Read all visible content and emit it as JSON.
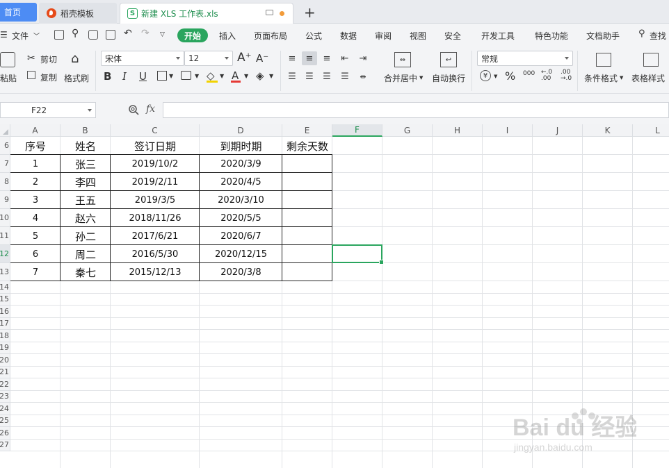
{
  "tabs": {
    "home": "首页",
    "template": "稻壳模板",
    "file": "新建 XLS 工作表.xls",
    "add": "+"
  },
  "menu": {
    "file": "文件",
    "items": [
      "开始",
      "插入",
      "页面布局",
      "公式",
      "数据",
      "审阅",
      "视图",
      "安全",
      "开发工具",
      "特色功能",
      "文档助手"
    ],
    "search": "查找"
  },
  "ribbon": {
    "paste": "粘贴",
    "cut": "剪切",
    "copy": "复制",
    "format_painter": "格式刷",
    "font_name": "宋体",
    "font_size": "12",
    "merge_center": "合并居中",
    "auto_wrap": "自动换行",
    "number_format": "常规",
    "conditional_format": "条件格式",
    "table_style": "表格样式",
    "bold": "B",
    "italic": "I",
    "underline": "U",
    "font_color": "A",
    "grow_font": "A⁺",
    "shrink_font": "A⁻",
    "percent": "%",
    "thousands": "000"
  },
  "formula_bar": {
    "name_box": "F22",
    "fx": "fx",
    "formula": ""
  },
  "columns": [
    "A",
    "B",
    "C",
    "D",
    "E",
    "F",
    "G",
    "H",
    "I",
    "J",
    "K",
    "L"
  ],
  "active_column": "F",
  "rows": [
    "6",
    "7",
    "8",
    "9",
    "10",
    "11",
    "12",
    "13",
    "14",
    "15",
    "16",
    "17",
    "18",
    "19",
    "20",
    "21",
    "22",
    "23",
    "24",
    "25",
    "26",
    "27"
  ],
  "active_row": "12",
  "table": {
    "headers": [
      "序号",
      "姓名",
      "签订日期",
      "到期时期",
      "剩余天数"
    ],
    "rows": [
      [
        "1",
        "张三",
        "2019/10/2",
        "2020/3/9",
        ""
      ],
      [
        "2",
        "李四",
        "2019/2/11",
        "2020/4/5",
        ""
      ],
      [
        "3",
        "王五",
        "2019/3/5",
        "2020/3/10",
        ""
      ],
      [
        "4",
        "赵六",
        "2018/11/26",
        "2020/5/5",
        ""
      ],
      [
        "5",
        "孙二",
        "2017/6/21",
        "2020/6/7",
        ""
      ],
      [
        "6",
        "周二",
        "2016/5/30",
        "2020/12/15",
        ""
      ],
      [
        "7",
        "秦七",
        "2015/12/13",
        "2020/3/8",
        ""
      ]
    ]
  },
  "watermark": {
    "brand": "Bai du 经验",
    "url": "jingyan.baidu.com"
  },
  "colors": {
    "accent_green": "#2aa55e",
    "home_tab_blue": "#4d8cf4"
  }
}
